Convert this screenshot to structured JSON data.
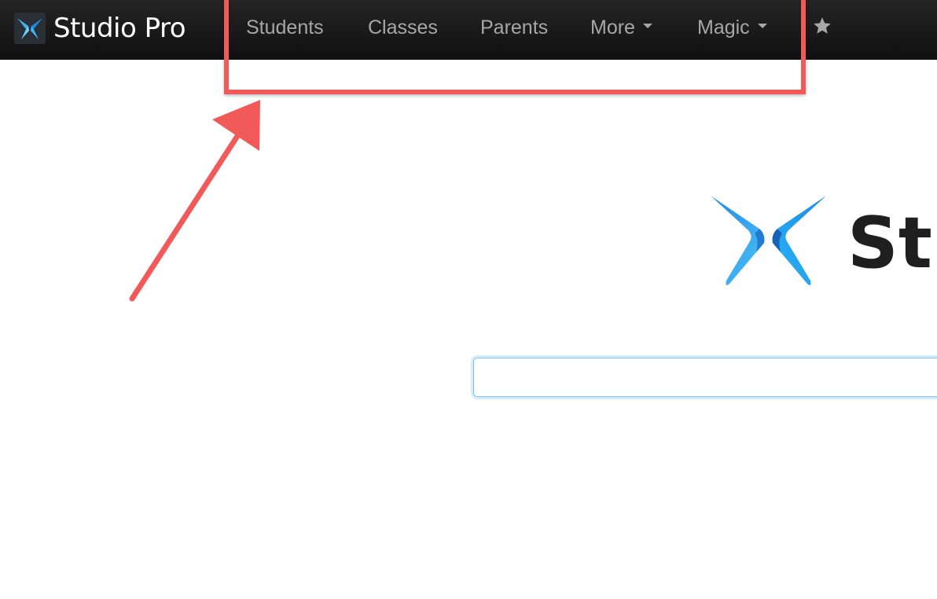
{
  "navbar": {
    "brand_label": "Studio Pro",
    "brand_icon": "studio-pro-logo-icon",
    "items": [
      {
        "label": "Students"
      },
      {
        "label": "Classes"
      },
      {
        "label": "Parents"
      },
      {
        "label": "More",
        "dropdown": true
      },
      {
        "label": "Magic",
        "dropdown": true
      }
    ],
    "favorites_icon": "star-icon"
  },
  "hero": {
    "logo_icon": "studio-pro-logo-icon",
    "title": "Stu"
  },
  "search": {
    "value": "",
    "placeholder": ""
  },
  "annotation": {
    "box_color": "#f25a5a",
    "arrow_color": "#f25a5a"
  },
  "colors": {
    "navbar_bg": "#181818",
    "nav_text": "#a7a7a7",
    "brand_text": "#ffffff",
    "logo_blue_dark": "#1565c0",
    "logo_blue_light": "#4fc3f7",
    "hero_text": "#1f1f1f",
    "input_focus_border": "#80bdff"
  }
}
